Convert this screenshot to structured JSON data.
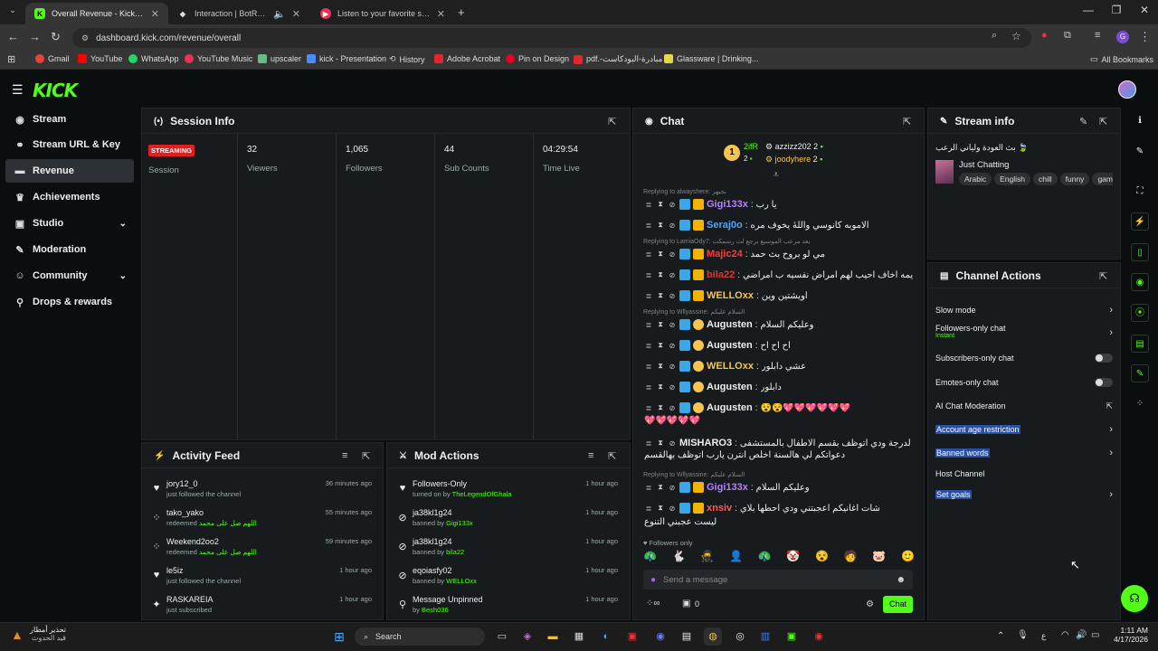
{
  "browser": {
    "tabs": [
      {
        "title": "Overall Revenue - Kick Dashboard",
        "favicon": "K",
        "color": "#53fc18",
        "active": true
      },
      {
        "title": "Interaction | BotRix — Cloud",
        "favicon": "B",
        "color": "#e8e8e8",
        "active": false
      },
      {
        "title": "Listen to your favorite songs and",
        "favicon": "▶",
        "color": "#e8335a",
        "active": false
      }
    ],
    "url": "dashboard.kick.com/revenue/overall",
    "bookmarks": [
      "Gmail",
      "YouTube",
      "WhatsApp",
      "YouTube Music",
      "upscaler",
      "kick - Presentation",
      "History",
      "Adobe Acrobat",
      "Pin on Design",
      "pdf.-مبادرة-البودكاست",
      "Glassware | Drinking..."
    ],
    "all_bookmarks": "All Bookmarks"
  },
  "sidebar": {
    "items": [
      {
        "label": "Stream",
        "icon": "stream-icon",
        "glyph": "◉"
      },
      {
        "label": "Stream URL & Key",
        "icon": "link-icon",
        "glyph": "⚭"
      },
      {
        "label": "Revenue",
        "icon": "revenue-icon",
        "glyph": "▬"
      },
      {
        "label": "Achievements",
        "icon": "trophy-icon",
        "glyph": "♛"
      },
      {
        "label": "Studio",
        "icon": "studio-icon",
        "glyph": "▣"
      },
      {
        "label": "Moderation",
        "icon": "wrench-icon",
        "glyph": "✎"
      },
      {
        "label": "Community",
        "icon": "community-icon",
        "glyph": "☺"
      },
      {
        "label": "Drops & rewards",
        "icon": "drops-icon",
        "glyph": "⚲"
      }
    ]
  },
  "session": {
    "title": "Session Info",
    "status": "STREAMING",
    "session_label": "Session",
    "viewers": "32",
    "viewers_label": "Viewers",
    "followers": "1,065",
    "followers_label": "Followers",
    "subs": "44",
    "subs_label": "Sub Counts",
    "time": "04:29:54",
    "time_label": "Time Live"
  },
  "activity": {
    "title": "Activity Feed",
    "rows": [
      {
        "name": "jory12_0",
        "sub": "just followed the channel",
        "time": "36 minutes ago",
        "icon": "♥"
      },
      {
        "name": "tako_yako",
        "sub": "redeemed",
        "extra": "اللهم صل على محمد",
        "time": "55 minutes ago",
        "icon": "⁘"
      },
      {
        "name": "Weekend2oo2",
        "sub": "redeemed",
        "extra": "اللهم صل على محمد",
        "time": "59 minutes ago",
        "icon": "⁘"
      },
      {
        "name": "le5iz",
        "sub": "just followed the channel",
        "time": "1 hour ago",
        "icon": "♥"
      },
      {
        "name": "RASKAREIA",
        "sub": "just subscribed",
        "time": "1 hour ago",
        "icon": "✦"
      }
    ]
  },
  "mod": {
    "title": "Mod Actions",
    "rows": [
      {
        "name": "Followers-Only",
        "sub": "turned on by",
        "by": "TheLegendOfGhala",
        "time": "1 hour ago",
        "icon": "♥"
      },
      {
        "name": "ja38kl1g24",
        "sub": "banned by",
        "by": "Gigi133x",
        "time": "1 hour ago",
        "icon": "⊘"
      },
      {
        "name": "ja38kl1g24",
        "sub": "banned by",
        "by": "bila22",
        "time": "1 hour ago",
        "icon": "⊘"
      },
      {
        "name": "eqoiasfy02",
        "sub": "banned by",
        "by": "WELLOxx",
        "time": "1 hour ago",
        "icon": "⊘"
      },
      {
        "name": "Message Unpinned",
        "sub": "by",
        "by": "Besh036",
        "time": "1 hour ago",
        "icon": "⚲"
      }
    ]
  },
  "chat": {
    "title": "Chat",
    "gifter1": "2ifR",
    "g1count": "2",
    "gifter2": "azzizz202",
    "g2count": "2",
    "gifter3": "joodyhere",
    "g3count": "2",
    "messages": [
      {
        "reply": "Replying to alwayshere: بجبهر",
        "user": "Gigi133x",
        "color": "#b580ff",
        "text": "يا رب"
      },
      {
        "user": "Seraj0o",
        "color": "#4aa6ff",
        "text": "الاموبه كانوسي واللهٔ يخوف مره"
      },
      {
        "reply": "Replying to LamiaOdy7: بعد مرعب الموسيع برجع لث رسمكت",
        "user": "Majic24",
        "color": "#ff3b3b",
        "text": "مي لو بروح بث حمد"
      },
      {
        "user": "bila22",
        "color": "#d43a3a",
        "text": "يمه اخاف احيب لهم امراض نفسيه ب امراضي"
      },
      {
        "user": "WELLOxx",
        "color": "#f5c451",
        "text": "اويشتين وين"
      },
      {
        "reply": "Replying to Wllyassine: السلام عليكم",
        "user": "Augusten",
        "color": "#eeeeee",
        "text": "وعليكم السلام"
      },
      {
        "user": "Augusten",
        "color": "#eeeeee",
        "text": "اح اح اح"
      },
      {
        "user": "WELLOxx",
        "color": "#f5c451",
        "text": "عشي دابلور"
      },
      {
        "user": "Augusten",
        "color": "#eeeeee",
        "text": "دابلور"
      },
      {
        "user": "Augusten",
        "color": "#eeeeee",
        "text": "😵😵💖💖💖💖💖💖"
      },
      {
        "user": "MISHARO3",
        "color": "#eeeeee",
        "text": "لدرجة ودي اتوظف بقسم الاطفال بالمستشفى"
      },
      {
        "reply": "Replying to Wllyassine: السلام عليكم",
        "user": "Gigi133x",
        "color": "#b580ff",
        "text": "وعليكم السلام"
      },
      {
        "user": "xnsiv",
        "color": "#ff5a4e",
        "text": "شات اغانيكم اعجبتني ودي احطها بلاي"
      }
    ],
    "extra_line1": "💖💖💖💖💖",
    "extra_line2": "دعواتكم لي هالسنة اخلص انترن يارب اتوظف بهالقسم",
    "extra_line3": "ليست عجبني التنوع",
    "followers_only": "Followers only",
    "placeholder": "Send a message",
    "count": "0",
    "chat_button": "Chat"
  },
  "streaminfo": {
    "title": "Stream info",
    "stream_title": "بث العودة ولياني الرعب 🍃",
    "category": "Just Chatting",
    "tags": [
      "Arabic",
      "English",
      "chill",
      "funny",
      "gaming"
    ]
  },
  "channel_actions": {
    "title": "Channel Actions",
    "slow": "Slow mode",
    "followers_only": "Followers-only chat",
    "instant": "Instant",
    "subs_only": "Subscribers-only chat",
    "emotes_only": "Emotes-only chat",
    "ai_mod": "AI Chat Moderation",
    "account_age": "Account age restriction",
    "banned_words": "Banned words",
    "host": "Host Channel",
    "goals": "Set goals"
  },
  "taskbar": {
    "weather_line1": "تحذير أمطار",
    "weather_line2": "قيد الحدوث",
    "search": "Search",
    "lang": "ع",
    "time": "1:11 AM",
    "date": "4/17/2026"
  }
}
